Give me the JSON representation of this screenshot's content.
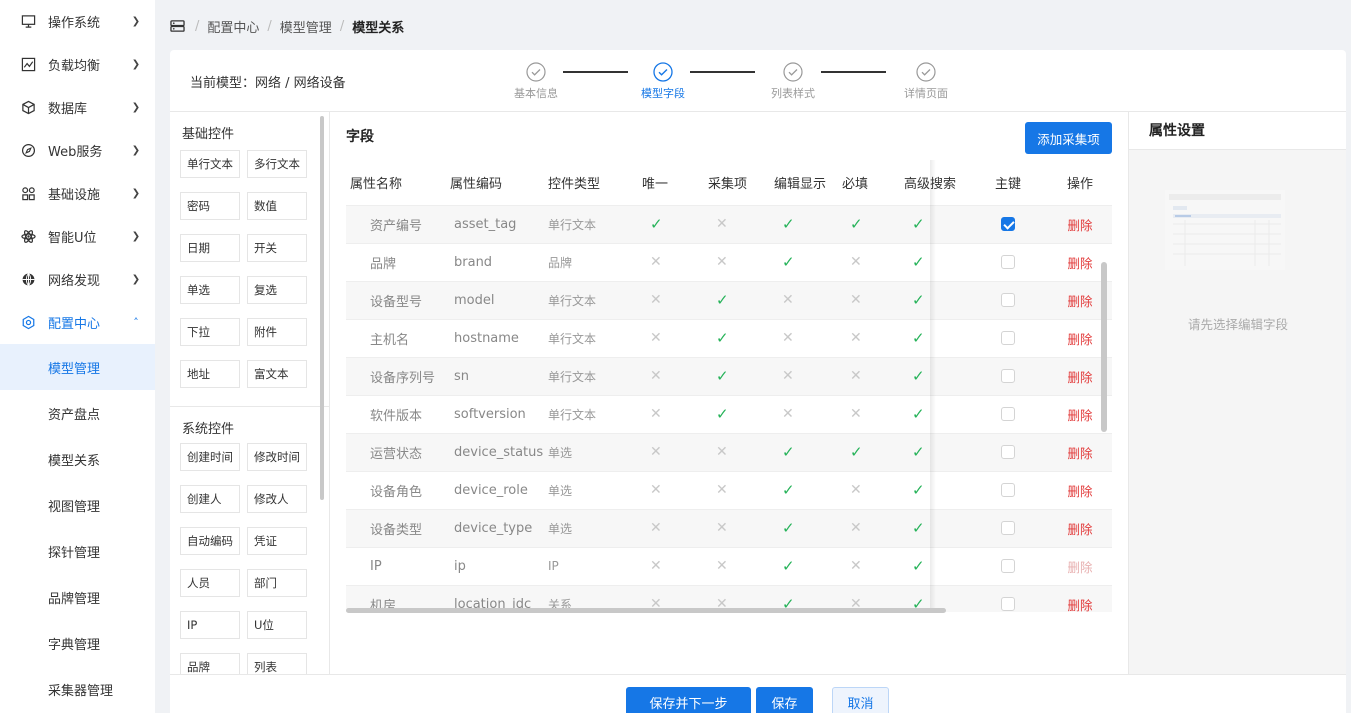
{
  "sidebar": {
    "items": [
      {
        "label": "操作系统",
        "icon": "monitor-icon"
      },
      {
        "label": "负载均衡",
        "icon": "chart-line-icon"
      },
      {
        "label": "数据库",
        "icon": "cube-icon"
      },
      {
        "label": "Web服务",
        "icon": "compass-icon"
      },
      {
        "label": "基础设施",
        "icon": "grid-icon"
      },
      {
        "label": "智能U位",
        "icon": "atom-icon"
      },
      {
        "label": "网络发现",
        "icon": "globe-icon"
      },
      {
        "label": "配置中心",
        "icon": "settings-icon"
      }
    ],
    "sub_items": [
      "模型管理",
      "资产盘点",
      "模型关系",
      "视图管理",
      "探针管理",
      "品牌管理",
      "字典管理",
      "采集器管理"
    ]
  },
  "breadcrumb": [
    "配置中心",
    "模型管理",
    "模型关系"
  ],
  "header": {
    "current_model": "当前模型：网络 / 网络设备"
  },
  "steps": [
    "基本信息",
    "模型字段",
    "列表样式",
    "详情页面"
  ],
  "controls": {
    "basic_title": "基础控件",
    "basic": [
      "单行文本",
      "多行文本",
      "密码",
      "数值",
      "日期",
      "开关",
      "单选",
      "复选",
      "下拉",
      "附件",
      "地址",
      "富文本"
    ],
    "system_title": "系统控件",
    "system": [
      "创建时间",
      "修改时间",
      "创建人",
      "修改人",
      "自动编码",
      "凭证",
      "人员",
      "部门",
      "IP",
      "U位",
      "品牌",
      "列表"
    ]
  },
  "fields": {
    "title": "字段",
    "add_button": "添加采集项",
    "columns": [
      "属性名称",
      "属性编码",
      "控件类型",
      "唯一",
      "采集项",
      "编辑显示",
      "必填",
      "高级搜索",
      "主键",
      "操作"
    ],
    "rows": [
      {
        "name": "资产编号",
        "code": "asset_tag",
        "type": "单行文本",
        "flags": [
          1,
          0,
          1,
          1,
          1
        ],
        "pk": true,
        "op": "删除"
      },
      {
        "name": "品牌",
        "code": "brand",
        "type": "品牌",
        "flags": [
          0,
          0,
          1,
          0,
          1
        ],
        "pk": false,
        "op": "删除"
      },
      {
        "name": "设备型号",
        "code": "model",
        "type": "单行文本",
        "flags": [
          0,
          1,
          0,
          0,
          1
        ],
        "pk": false,
        "op": "删除"
      },
      {
        "name": "主机名",
        "code": "hostname",
        "type": "单行文本",
        "flags": [
          0,
          1,
          0,
          0,
          1
        ],
        "pk": false,
        "op": "删除"
      },
      {
        "name": "设备序列号",
        "code": "sn",
        "type": "单行文本",
        "flags": [
          0,
          1,
          0,
          0,
          1
        ],
        "pk": false,
        "op": "删除"
      },
      {
        "name": "软件版本",
        "code": "softversion",
        "type": "单行文本",
        "flags": [
          0,
          1,
          0,
          0,
          1
        ],
        "pk": false,
        "op": "删除"
      },
      {
        "name": "运营状态",
        "code": "device_status",
        "type": "单选",
        "flags": [
          0,
          0,
          1,
          1,
          1
        ],
        "pk": false,
        "op": "删除"
      },
      {
        "name": "设备角色",
        "code": "device_role",
        "type": "单选",
        "flags": [
          0,
          0,
          1,
          0,
          1
        ],
        "pk": false,
        "op": "删除"
      },
      {
        "name": "设备类型",
        "code": "device_type",
        "type": "单选",
        "flags": [
          0,
          0,
          1,
          0,
          1
        ],
        "pk": false,
        "op": "删除"
      },
      {
        "name": "IP",
        "code": "ip",
        "type": "IP",
        "flags": [
          0,
          0,
          1,
          0,
          1
        ],
        "pk": false,
        "op": "删除",
        "op_disabled": true
      },
      {
        "name": "机房",
        "code": "location_idc",
        "type": "关系",
        "flags": [
          0,
          0,
          1,
          0,
          1
        ],
        "pk": false,
        "op": "删除"
      }
    ]
  },
  "props": {
    "title": "属性设置",
    "empty": "请先选择编辑字段"
  },
  "footer": {
    "save_next": "保存并下一步",
    "save": "保存",
    "cancel": "取消"
  },
  "colors": {
    "primary": "#1677e6",
    "check": "#27b35a",
    "danger": "#e23b3b"
  }
}
